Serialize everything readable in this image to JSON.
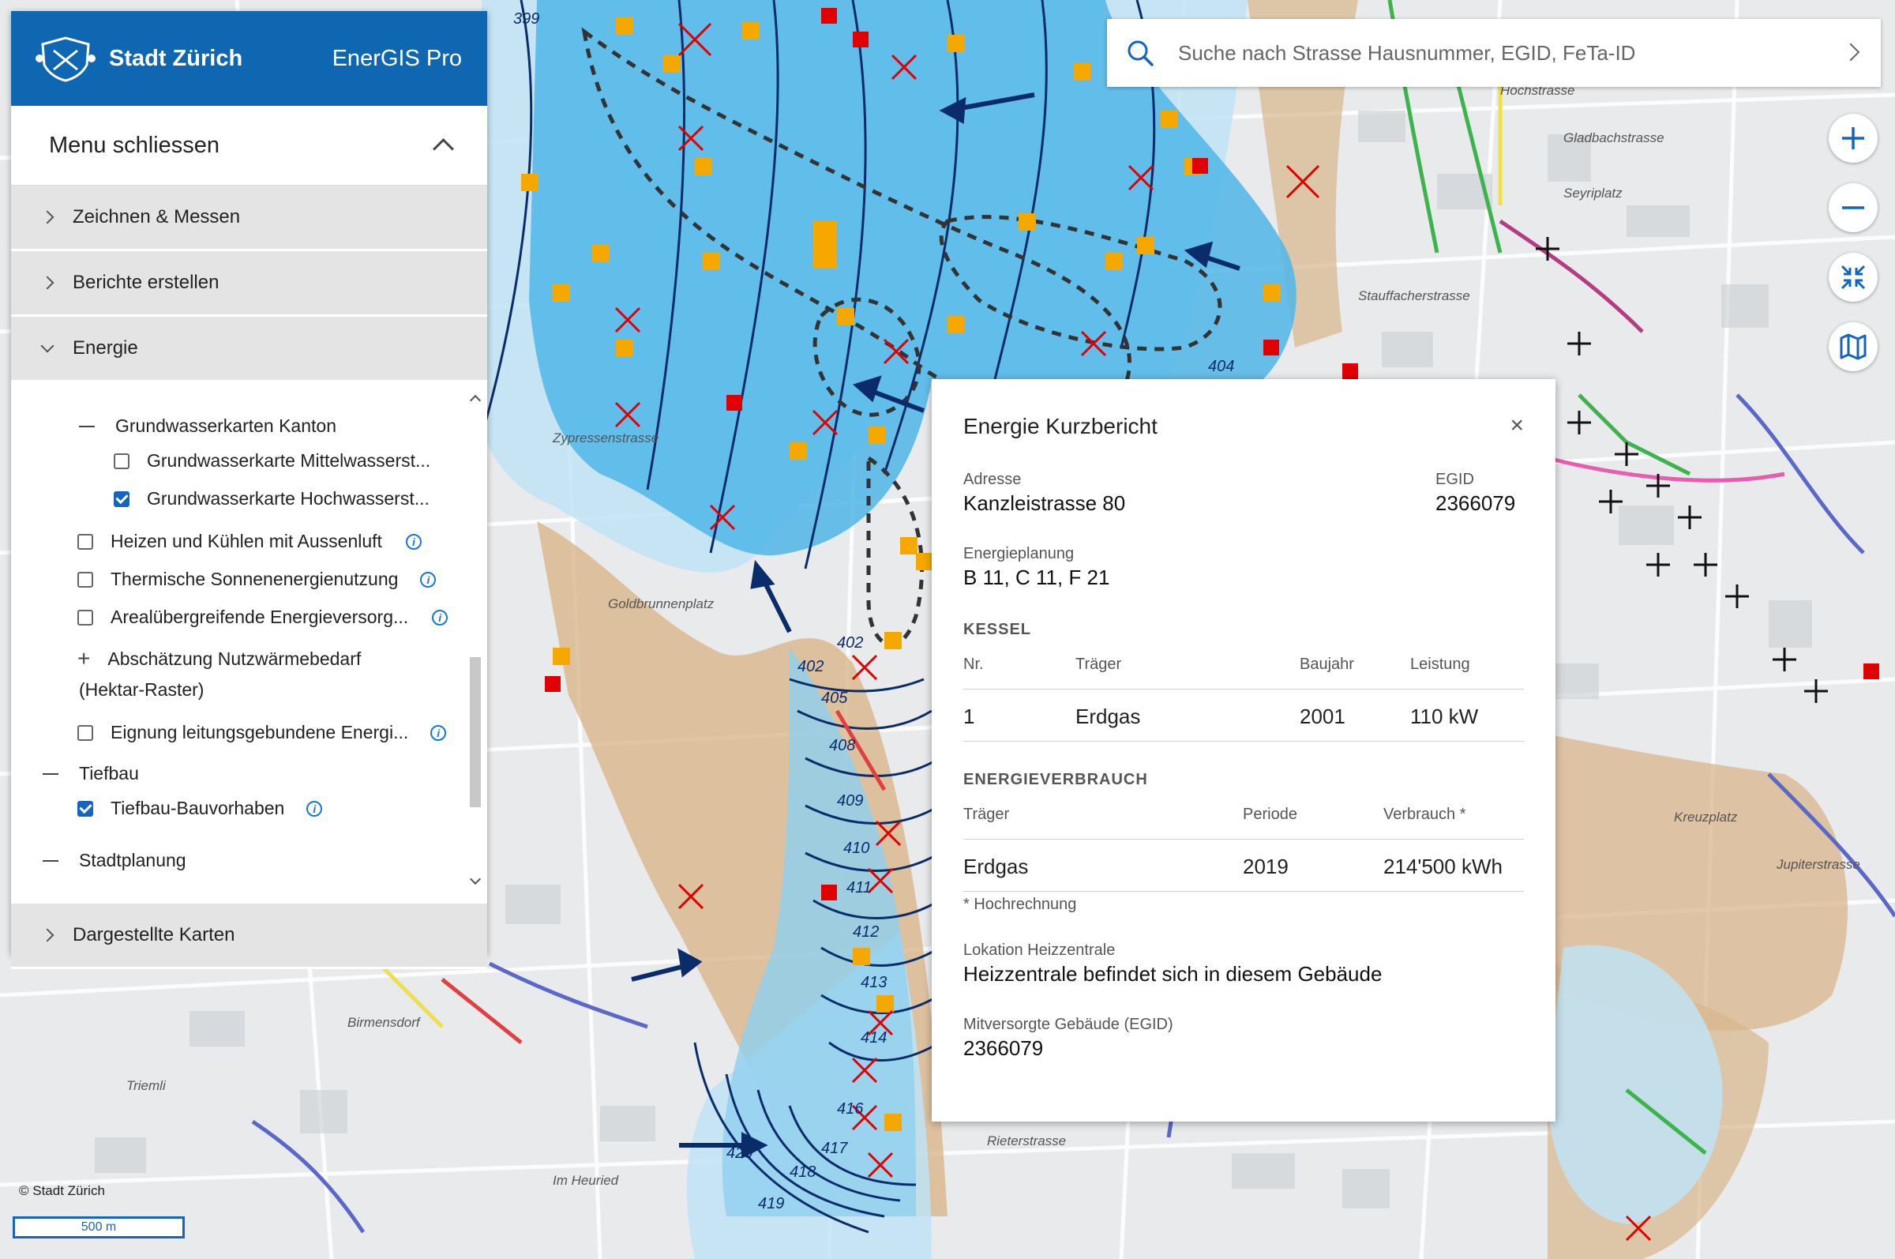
{
  "app": {
    "brand": "Stadt Zürich",
    "product": "EnerGIS Pro"
  },
  "menu": {
    "close_label": "Menu schliessen",
    "sections": [
      "Zeichnen & Messen",
      "Berichte erstellen",
      "Energie"
    ],
    "bottom_section": "Dargestellte Karten",
    "energy_items": {
      "group_gw": "Grundwasserkarten Kanton",
      "gw_mittel": "Grundwasserkarte Mittelwasserst...",
      "gw_hoch": "Grundwasserkarte Hochwasserst...",
      "aussenluft": "Heizen und Kühlen mit Aussenluft",
      "sonne": "Thermische Sonnenenergienutzung",
      "areal": "Arealübergreifende Energieversorg...",
      "nutz_line1": "Abschätzung Nutzwärmebedarf",
      "nutz_line2": "(Hektar-Raster)",
      "eignung": "Eignung leitungsgebundene Energi...",
      "tiefbau_group": "Tiefbau",
      "tiefbau_item": "Tiefbau-Bauvorhaben",
      "stadtplanung": "Stadtplanung"
    },
    "checked": {
      "gw_mittel": false,
      "gw_hoch": true,
      "aussenluft": false,
      "sonne": false,
      "areal": false,
      "eignung": false,
      "tiefbau_item": true
    }
  },
  "search": {
    "placeholder": "Suche nach Strasse Hausnummer, EGID, FeTa-ID"
  },
  "tools": [
    "zoom-in",
    "zoom-out",
    "fit-extent",
    "map-layers"
  ],
  "popup": {
    "title": "Energie Kurzbericht",
    "close": "×",
    "address_label": "Adresse",
    "address": "Kanzleistrasse 80",
    "egid_label": "EGID",
    "egid": "2366079",
    "planning_label": "Energieplanung",
    "planning": "B 11, C 11, F 21",
    "kessel_heading": "KESSEL",
    "kessel_headers": [
      "Nr.",
      "Träger",
      "Baujahr",
      "Leistung"
    ],
    "kessel_row": [
      "1",
      "Erdgas",
      "2001",
      "110 kW"
    ],
    "verbrauch_heading": "ENERGIEVERBRAUCH",
    "verbrauch_headers": [
      "Träger",
      "Periode",
      "Verbrauch *"
    ],
    "verbrauch_row": [
      "Erdgas",
      "2019",
      "214'500 kWh"
    ],
    "footnote": "* Hochrechnung",
    "location_label": "Lokation Heizzentrale",
    "location": "Heizzentrale befindet sich in diesem Gebäude",
    "supplied_label": "Mitversorgte Gebäude (EGID)",
    "supplied": "2366079"
  },
  "map": {
    "copyright": "© Stadt Zürich",
    "scale": "500 m",
    "contour_labels": [
      "399",
      "402",
      "402",
      "404",
      "405",
      "408",
      "409",
      "410",
      "411",
      "412",
      "413",
      "414",
      "416",
      "417",
      "418",
      "419",
      "420"
    ],
    "street_labels": [
      "Zypressenstrasse",
      "Goldbrunnenplatz",
      "Rieterstrasse",
      "Stauffacherstrasse",
      "Hochstrasse",
      "Gladbachstrasse",
      "Seyriplatz",
      "Kreuzplatz",
      "Jupiterstrasse",
      "Birmensdorf",
      "Im Heuried",
      "Triemli"
    ],
    "colors": {
      "groundwater": "#4fb6e8",
      "groundwater_light": "#bfe3f5",
      "terrain": "#d9b68c",
      "accent": "#0f67b1"
    }
  }
}
